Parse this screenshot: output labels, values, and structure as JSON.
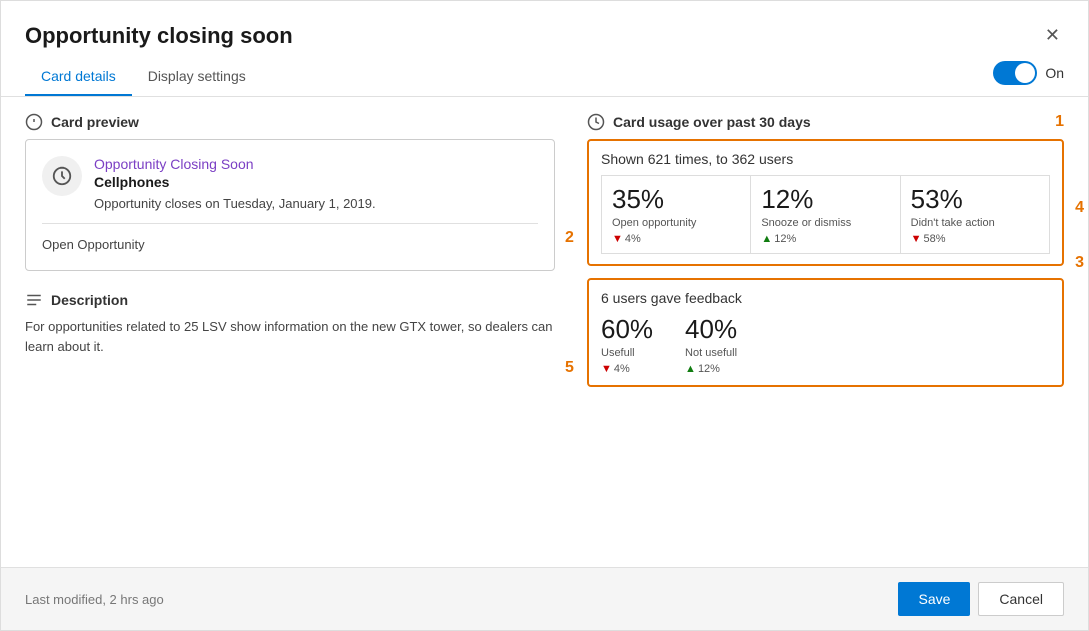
{
  "dialog": {
    "title": "Opportunity closing soon",
    "close_icon": "✕"
  },
  "tabs": {
    "tab1": "Card details",
    "tab2": "Display settings",
    "toggle_label": "On"
  },
  "left": {
    "card_preview_label": "Card preview",
    "card": {
      "title_link": "Opportunity Closing Soon",
      "subtitle": "Cellphones",
      "body": "Opportunity closes on Tuesday, January 1, 2019.",
      "action": "Open Opportunity"
    },
    "description_label": "Description",
    "description_text": "For opportunities related to 25 LSV show information on the new GTX tower, so dealers can learn about it."
  },
  "right": {
    "usage_label": "Card usage over past 30 days",
    "annotation1": "1",
    "annotation2": "2",
    "annotation3": "3",
    "annotation4": "4",
    "annotation5": "5",
    "shown_text": "Shown 621 times, to 362 users",
    "stats": [
      {
        "pct": "35%",
        "desc": "Open opportunity",
        "change_dir": "down",
        "change": "4%"
      },
      {
        "pct": "12%",
        "desc": "Snooze or dismiss",
        "change_dir": "up",
        "change": "12%"
      },
      {
        "pct": "53%",
        "desc": "Didn't take action",
        "change_dir": "down",
        "change": "58%"
      }
    ],
    "feedback_header": "6 users gave feedback",
    "feedback": [
      {
        "pct": "60%",
        "desc": "Usefull",
        "change_dir": "down",
        "change": "4%"
      },
      {
        "pct": "40%",
        "desc": "Not usefull",
        "change_dir": "up",
        "change": "12%"
      }
    ]
  },
  "footer": {
    "modified": "Last modified, 2 hrs ago",
    "save": "Save",
    "cancel": "Cancel"
  }
}
